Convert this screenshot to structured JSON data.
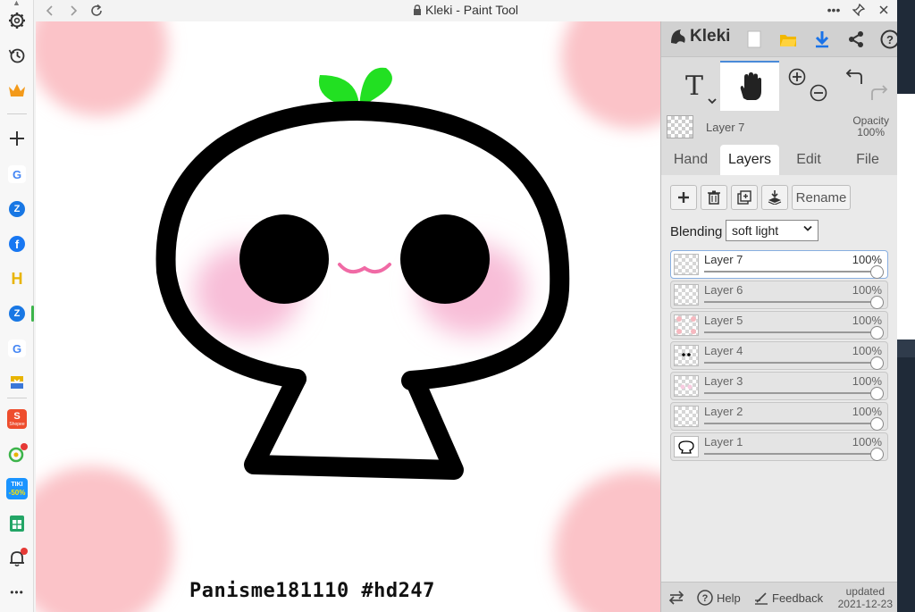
{
  "window": {
    "title": "Kleki - Paint Tool"
  },
  "sidebar": {
    "items": [
      {
        "name": "settings-icon"
      },
      {
        "name": "history-icon"
      },
      {
        "name": "crown-icon"
      },
      {
        "name": "add-icon"
      },
      {
        "name": "google-icon",
        "label": "G"
      },
      {
        "name": "zalo-icon"
      },
      {
        "name": "facebook-icon",
        "label": "f"
      },
      {
        "name": "h-app-icon",
        "label": "H"
      },
      {
        "name": "zalo-icon-2"
      },
      {
        "name": "google-icon-2",
        "label": "G"
      },
      {
        "name": "download-app-icon"
      },
      {
        "name": "shopee-icon",
        "label": "Shopee"
      },
      {
        "name": "grab-icon"
      },
      {
        "name": "tiki-icon",
        "label_top": "TIKI",
        "label_bottom": "-50%"
      },
      {
        "name": "sheets-icon"
      },
      {
        "name": "bell-icon"
      },
      {
        "name": "more-icon",
        "label": "•••"
      }
    ]
  },
  "canvas": {
    "signature": "Panisme181110 #hd247",
    "colors": {
      "blob": "#fbc3c8",
      "blush": "#f8bed8",
      "sprout": "#22e022",
      "mouth": "#f06aa5",
      "line": "#000000"
    }
  },
  "panel": {
    "brand": "Kleki",
    "top_layer": {
      "name": "Layer 7",
      "opacity_label": "Opacity",
      "opacity_value": "100%"
    },
    "tabs": [
      {
        "label": "Hand",
        "active": false
      },
      {
        "label": "Layers",
        "active": true
      },
      {
        "label": "Edit",
        "active": false
      },
      {
        "label": "File",
        "active": false
      }
    ],
    "rename_label": "Rename",
    "blending_label": "Blending",
    "blending_value": "soft light",
    "layers": [
      {
        "name": "Layer 7",
        "opacity": "100%",
        "selected": true
      },
      {
        "name": "Layer 6",
        "opacity": "100%",
        "selected": false
      },
      {
        "name": "Layer 5",
        "opacity": "100%",
        "selected": false
      },
      {
        "name": "Layer 4",
        "opacity": "100%",
        "selected": false
      },
      {
        "name": "Layer 3",
        "opacity": "100%",
        "selected": false
      },
      {
        "name": "Layer 2",
        "opacity": "100%",
        "selected": false
      },
      {
        "name": "Layer 1",
        "opacity": "100%",
        "selected": false
      }
    ],
    "footer": {
      "help": "Help",
      "feedback": "Feedback",
      "updated_label": "updated",
      "updated_date": "2021-12-23"
    }
  }
}
